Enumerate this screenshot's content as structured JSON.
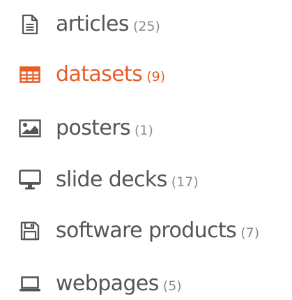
{
  "accent_color": "#e85d26",
  "text_color": "#555555",
  "count_color": "#8a8a8a",
  "nav": {
    "items": [
      {
        "label": "articles",
        "count": "(25)",
        "icon": "file-text-icon",
        "active": false
      },
      {
        "label": "datasets",
        "count": "(9)",
        "icon": "table-icon",
        "active": true
      },
      {
        "label": "posters",
        "count": "(1)",
        "icon": "image-icon",
        "active": false
      },
      {
        "label": "slide decks",
        "count": "(17)",
        "icon": "monitor-icon",
        "active": false
      },
      {
        "label": "software products",
        "count": "(7)",
        "icon": "floppy-disk-icon",
        "active": false
      },
      {
        "label": "webpages",
        "count": "(5)",
        "icon": "laptop-icon",
        "active": false
      }
    ]
  }
}
